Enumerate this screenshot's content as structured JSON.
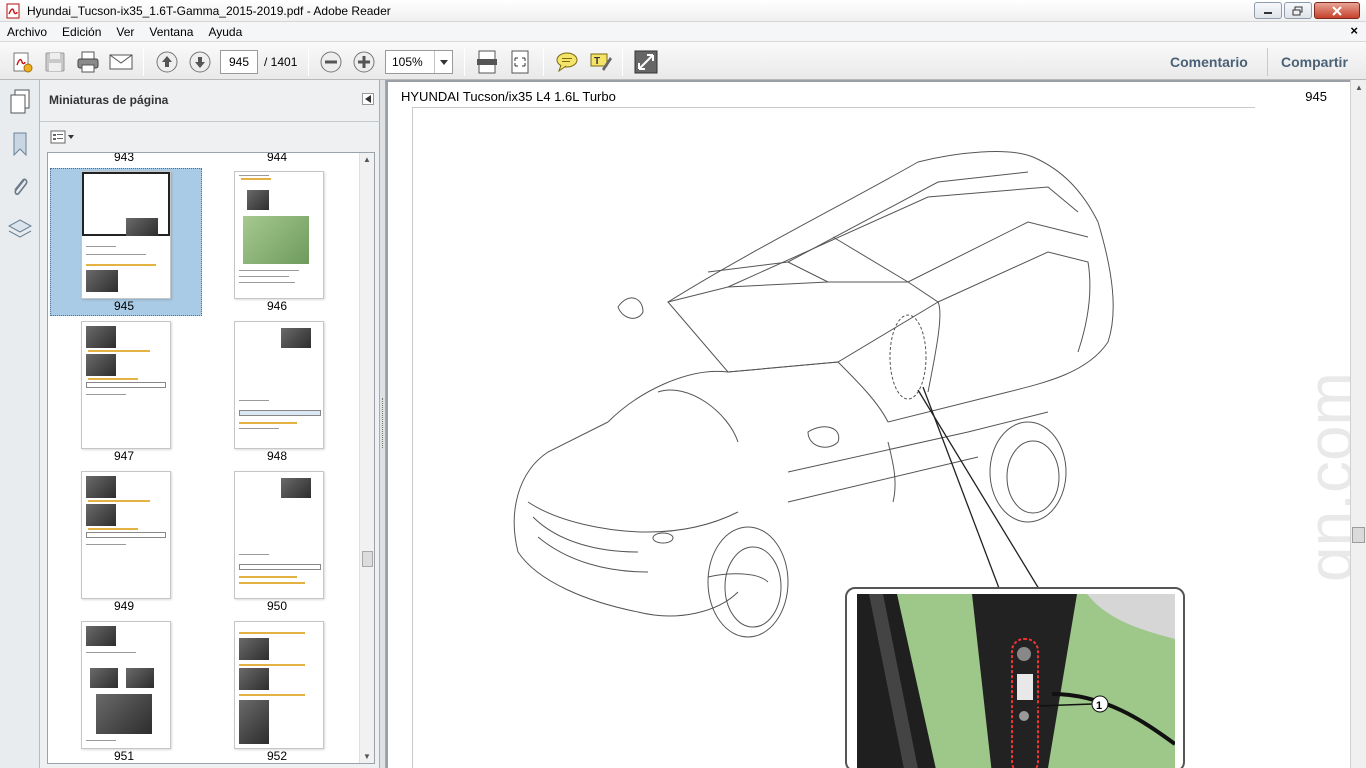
{
  "window": {
    "title": "Hyundai_Tucson-ix35_1.6T-Gamma_2015-2019.pdf - Adobe Reader"
  },
  "menu": {
    "items": [
      "Archivo",
      "Edición",
      "Ver",
      "Ventana",
      "Ayuda"
    ],
    "close_glyph": "×"
  },
  "toolbar": {
    "current_page": "945",
    "total_pages": "/ 1401",
    "zoom": "105%",
    "comment_label": "Comentario",
    "share_label": "Compartir"
  },
  "panel": {
    "title": "Miniaturas de página",
    "thumbnails": [
      {
        "page": "943"
      },
      {
        "page": "944"
      },
      {
        "page": "945",
        "selected": true
      },
      {
        "page": "946"
      },
      {
        "page": "947"
      },
      {
        "page": "948"
      },
      {
        "page": "949"
      },
      {
        "page": "950"
      },
      {
        "page": "951"
      },
      {
        "page": "952"
      }
    ]
  },
  "document": {
    "header_left": "HYUNDAI Tucson/ix35 L4 1.6L Turbo",
    "header_right": "945",
    "callout_number": "1",
    "watermark": "gn.com"
  },
  "colors": {
    "selection": "#aacbe5",
    "accent_link": "#4a6177",
    "photo_green": "#9ec78a",
    "highlight_yellow": "#e4b243"
  }
}
